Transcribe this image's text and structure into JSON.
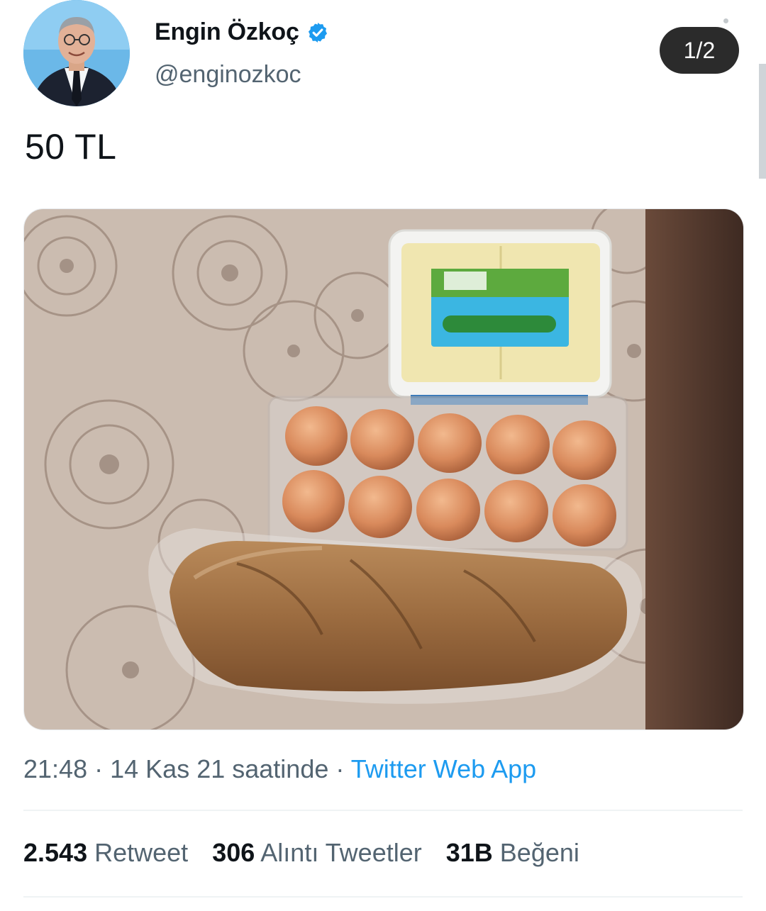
{
  "author": {
    "display_name": "Engin Özkoç",
    "handle": "@enginozkoc",
    "verified_icon": "verified-badge-icon",
    "avatar_icon": "profile-photo"
  },
  "media_counter": "1/2",
  "tweet": {
    "text": "50 TL",
    "photo_icon": "groceries-photo"
  },
  "meta": {
    "time": "21:48",
    "separator": "·",
    "date": "14 Kas 21 saatinde",
    "source": "Twitter Web App"
  },
  "stats": {
    "retweets_count": "2.543",
    "retweets_label": "Retweet",
    "quotes_count": "306",
    "quotes_label": "Alıntı Tweetler",
    "likes_count": "31B",
    "likes_label": "Beğeni"
  },
  "colors": {
    "link": "#1d9bf0",
    "secondary_text": "#536471",
    "primary_text": "#0f1419"
  }
}
